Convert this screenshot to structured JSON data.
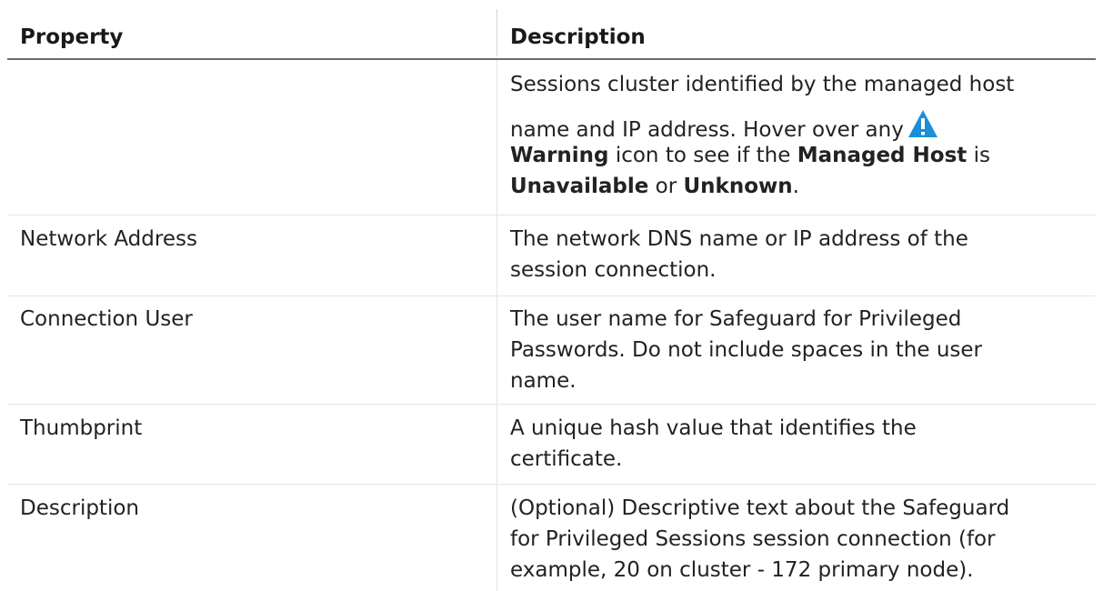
{
  "header": {
    "property": "Property",
    "description": "Description"
  },
  "row0": {
    "line1": "Sessions cluster identified by the managed host",
    "line2": "name and IP address. Hover over any",
    "w1": "Warning",
    "t1": " icon to see if the ",
    "w2": "Managed Host",
    "t2": " is",
    "w3": "Unavailable",
    "t3": " or ",
    "w4": "Unknown",
    "t4": "."
  },
  "rows": [
    {
      "property": "Network Address",
      "lines": [
        "The network DNS name or IP address of the",
        "session connection."
      ]
    },
    {
      "property": "Connection User",
      "lines": [
        "The user name for Safeguard for Privileged",
        "Passwords. Do not include spaces in the user",
        "name."
      ]
    },
    {
      "property": "Thumbprint",
      "lines": [
        "A unique hash value that identifies the",
        "certificate."
      ]
    },
    {
      "property": "Description",
      "lines": [
        "(Optional) Descriptive text about the Safeguard",
        "for Privileged Sessions session connection (for",
        "example, 20 on cluster - 172 primary node)."
      ]
    }
  ],
  "colors": {
    "warning_icon": "#1c8fd6"
  },
  "icons": {
    "warning": "warning-triangle-icon"
  }
}
